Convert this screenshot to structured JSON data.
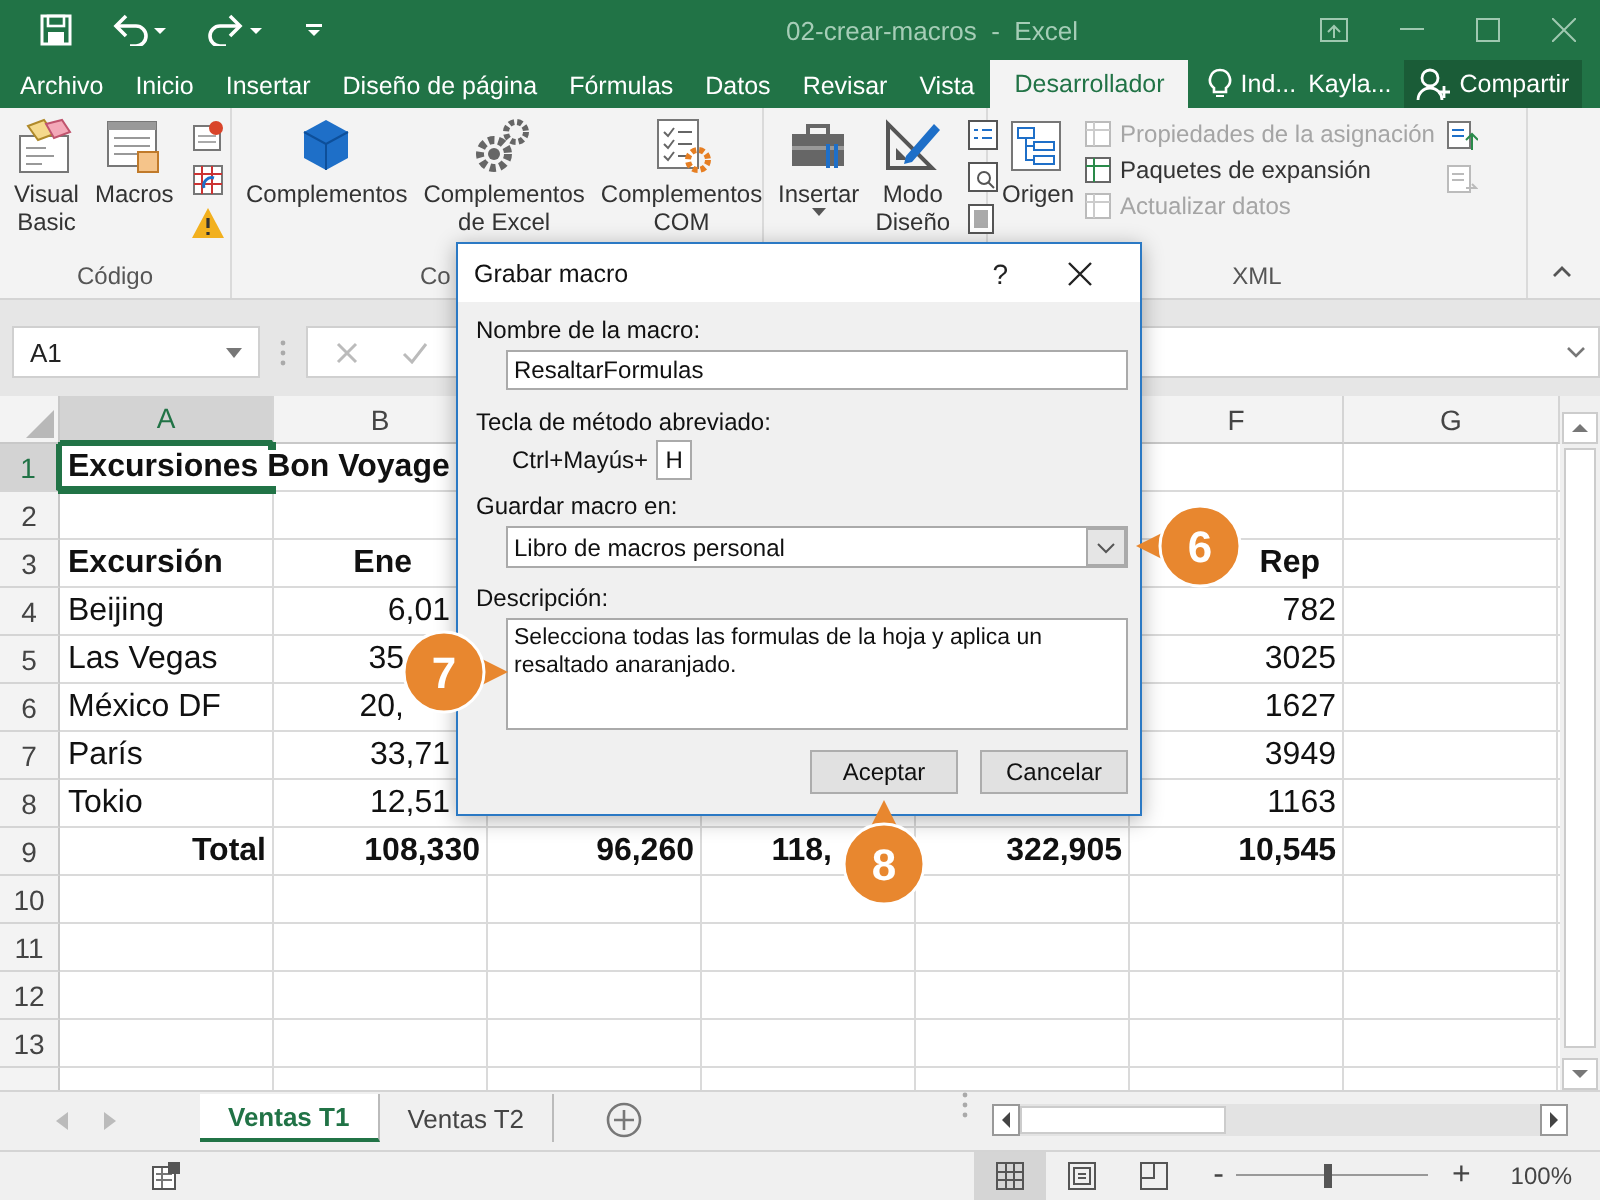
{
  "window": {
    "title": "02-crear-macros  -  Excel"
  },
  "tabs": [
    {
      "label": "Archivo",
      "selected": false
    },
    {
      "label": "Inicio",
      "selected": false
    },
    {
      "label": "Insertar",
      "selected": false
    },
    {
      "label": "Diseño de página",
      "selected": false
    },
    {
      "label": "Fórmulas",
      "selected": false
    },
    {
      "label": "Datos",
      "selected": false
    },
    {
      "label": "Revisar",
      "selected": false
    },
    {
      "label": "Vista",
      "selected": false
    },
    {
      "label": "Desarrollador",
      "selected": true
    }
  ],
  "tell_me": {
    "label": "Ind..."
  },
  "user": {
    "name": "Kayla..."
  },
  "share_button": {
    "label": "Compartir"
  },
  "ribbon": {
    "groups": [
      {
        "label": "Código",
        "items": [
          {
            "kind": "large",
            "label": "Visual Basic"
          },
          {
            "kind": "large",
            "label": "Macros"
          },
          {
            "kind": "icon-stack"
          }
        ]
      },
      {
        "label": "Co",
        "items": [
          {
            "kind": "large",
            "label": "Complementos"
          },
          {
            "kind": "large",
            "label": "Complementos de Excel"
          },
          {
            "kind": "large",
            "label": "Complementos COM"
          }
        ]
      },
      {
        "items": [
          {
            "kind": "large",
            "label": "Insertar",
            "dropdown": true
          },
          {
            "kind": "large",
            "label": "Modo Diseño"
          },
          {
            "kind": "icon-stack"
          }
        ]
      },
      {
        "label": "XML",
        "items": [
          {
            "kind": "large",
            "label": "Origen"
          },
          {
            "kind": "list",
            "entries": [
              {
                "label": "Propiedades de la asignación",
                "disabled": true
              },
              {
                "label": "Paquetes de expansión",
                "disabled": false
              },
              {
                "label": "Actualizar datos",
                "disabled": true
              }
            ]
          },
          {
            "kind": "icon-stack"
          }
        ]
      }
    ]
  },
  "formula_bar": {
    "name_box": "A1"
  },
  "sheet": {
    "columns": [
      {
        "label": "A",
        "selected": true
      },
      {
        "label": "B",
        "selected": false
      },
      null,
      null,
      null,
      {
        "label": "F",
        "selected": false
      },
      {
        "label": "G",
        "selected": false
      }
    ],
    "rows": [
      {
        "header": "1",
        "selected": true,
        "kind": "title",
        "cells": [
          "Excursiones Bon Voyage",
          null,
          null,
          null,
          null,
          null,
          null
        ]
      },
      {
        "header": "2",
        "selected": false,
        "cells": [
          null,
          null,
          null,
          null,
          null,
          null,
          null
        ]
      },
      {
        "header": "3",
        "selected": false,
        "kind": "heading",
        "cells": [
          "Excursión",
          "Ene",
          null,
          null,
          null,
          "Rep",
          null
        ]
      },
      {
        "header": "4",
        "selected": false,
        "kind": "data",
        "cells": [
          "Beijing",
          "6,01",
          null,
          null,
          null,
          "782",
          null
        ]
      },
      {
        "header": "5",
        "selected": false,
        "kind": "data",
        "cells": [
          "Las Vegas",
          "35",
          null,
          null,
          null,
          "3025",
          null
        ]
      },
      {
        "header": "6",
        "selected": false,
        "kind": "data",
        "cells": [
          "México DF",
          "20,",
          null,
          null,
          null,
          "1627",
          null
        ]
      },
      {
        "header": "7",
        "selected": false,
        "kind": "data",
        "cells": [
          "París",
          "33,71",
          null,
          null,
          null,
          "3949",
          null
        ]
      },
      {
        "header": "8",
        "selected": false,
        "kind": "data",
        "cells": [
          "Tokio",
          "12,51",
          null,
          null,
          null,
          "1163",
          null
        ]
      },
      {
        "header": "9",
        "selected": false,
        "kind": "total",
        "cells": [
          "Total",
          "108,330",
          "96,260",
          "118,",
          "322,905",
          "10,545",
          null
        ]
      },
      {
        "header": "10",
        "selected": false,
        "cells": [
          null,
          null,
          null,
          null,
          null,
          null,
          null
        ]
      },
      {
        "header": "11",
        "selected": false,
        "cells": [
          null,
          null,
          null,
          null,
          null,
          null,
          null
        ]
      },
      {
        "header": "12",
        "selected": false,
        "cells": [
          null,
          null,
          null,
          null,
          null,
          null,
          null
        ]
      },
      {
        "header": "13",
        "selected": false,
        "cells": [
          null,
          null,
          null,
          null,
          null,
          null,
          null
        ]
      }
    ]
  },
  "sheet_tabs": [
    {
      "label": "Ventas T1",
      "selected": true
    },
    {
      "label": "Ventas T2",
      "selected": false
    }
  ],
  "status_bar": {
    "views": [
      {
        "selected": true
      },
      {
        "selected": false
      },
      {
        "selected": false
      }
    ],
    "zoom_minus": "-",
    "zoom_plus": "+",
    "zoom_slider": {
      "level": 0.48
    },
    "zoom": "100%"
  },
  "dialog": {
    "title": "Grabar macro",
    "help": "?",
    "name_label": "Nombre de la macro:",
    "name_value": "ResaltarFormulas",
    "shortcut_label": "Tecla de método abreviado:",
    "shortcut_prefix": "Ctrl+Mayús+",
    "shortcut_key": "H",
    "store_label": "Guardar macro en:",
    "store_value": "Libro de macros personal",
    "description_label": "Descripción:",
    "description": "Selecciona todas las formulas de la hoja y aplica un resaltado anaranjado.",
    "buttons": [
      {
        "label": "Aceptar"
      },
      {
        "label": "Cancelar"
      }
    ]
  },
  "callouts": [
    {
      "number": "6"
    },
    {
      "number": "7"
    },
    {
      "number": "8"
    }
  ]
}
